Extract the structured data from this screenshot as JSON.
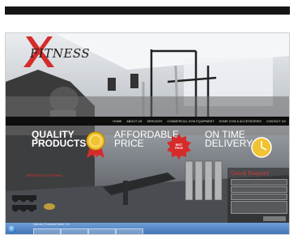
{
  "logo": {
    "text": "FITNESS",
    "icon": "x-logo-icon"
  },
  "nav": {
    "items": [
      "HOME",
      "ABOUT US",
      "SERVICES",
      "COMMERCIAL GYM EQUIPMENT",
      "HOME GYM & ACCESSORIES",
      "CONTACT US"
    ]
  },
  "features": [
    {
      "line1": "QUALITY",
      "line2": "PRODUCTS",
      "icon": "medal-icon"
    },
    {
      "line1": "AFFORDABLE",
      "line2": "PRICE",
      "icon": "price-badge-icon",
      "badge_line1": "BEST",
      "badge_line2": "PRICE"
    },
    {
      "line1": "ON TIME",
      "line2": "DELIVERY",
      "icon": "clock-icon"
    }
  ],
  "welcome": {
    "text": "Welcome to X Fitness"
  },
  "enquiry": {
    "title": "Quick Enquiry"
  },
  "taskbar": {
    "start_icon": "windows-start-icon",
    "text": "Internet | Protected Mode: On"
  },
  "colors": {
    "accent_red": "#d52b2b",
    "nav_bg": "#0e0e0e",
    "taskbar": "#4a7cc0"
  }
}
